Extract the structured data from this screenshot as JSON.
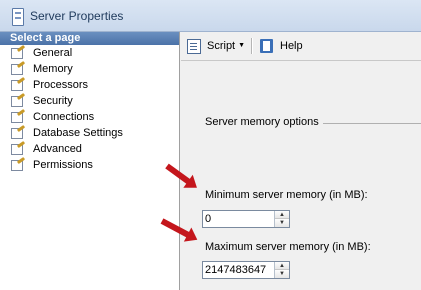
{
  "window": {
    "title": "Server Properties"
  },
  "sidebar": {
    "header": "Select a page",
    "items": [
      {
        "label": "General"
      },
      {
        "label": "Memory"
      },
      {
        "label": "Processors"
      },
      {
        "label": "Security"
      },
      {
        "label": "Connections"
      },
      {
        "label": "Database Settings"
      },
      {
        "label": "Advanced"
      },
      {
        "label": "Permissions"
      }
    ]
  },
  "toolbar": {
    "script_label": "Script",
    "help_label": "Help"
  },
  "memory": {
    "group_title": "Server memory options",
    "min_label": "Minimum server memory (in MB):",
    "min_value": "0",
    "max_label": "Maximum server memory (in MB):",
    "max_value": "2147483647"
  },
  "colors": {
    "annotation_arrow": "#c4161c",
    "sidebar_header": "#4b72a8"
  }
}
